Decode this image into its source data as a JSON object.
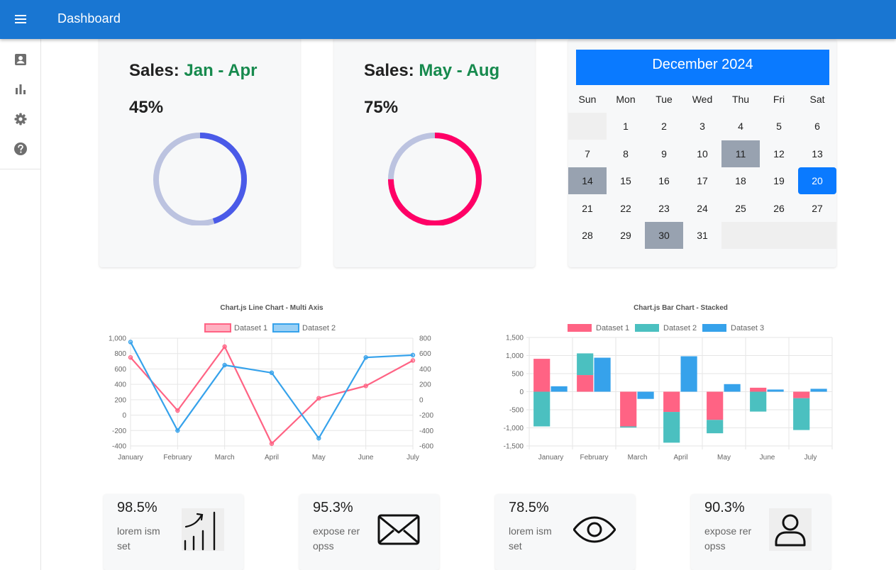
{
  "appbar": {
    "title": "Dashboard",
    "menu_icon": "menu-icon"
  },
  "sidebar": {
    "items": [
      {
        "icon": "contact-card-icon"
      },
      {
        "icon": "bar-chart-icon"
      },
      {
        "icon": "gear-icon"
      },
      {
        "icon": "help-icon"
      }
    ]
  },
  "sales": [
    {
      "prefix": "Sales: ",
      "range": "Jan - Apr",
      "percent_label": "45%",
      "percent": 45,
      "color": "#4a5ae8",
      "track": "#bcc3e0"
    },
    {
      "prefix": "Sales: ",
      "range": "May - Aug",
      "percent_label": "75%",
      "percent": 75,
      "color": "#ff0066",
      "track": "#bcc3e0"
    }
  ],
  "calendar": {
    "title": "December 2024",
    "weekdays": [
      "Sun",
      "Mon",
      "Tue",
      "Wed",
      "Thu",
      "Fri",
      "Sat"
    ],
    "days": [
      "1",
      "2",
      "3",
      "4",
      "5",
      "6",
      "7",
      "8",
      "9",
      "10",
      "11",
      "12",
      "13",
      "14",
      "15",
      "16",
      "17",
      "18",
      "19",
      "20",
      "21",
      "22",
      "23",
      "24",
      "25",
      "26",
      "27",
      "28",
      "29",
      "30",
      "31"
    ],
    "first_weekday": 1,
    "highlighted_days": [
      "11",
      "14",
      "30"
    ],
    "today": "20",
    "accent": "#0a7aff"
  },
  "chart_data": [
    {
      "type": "line",
      "title": "Chart.js Line Chart - Multi Axis",
      "categories": [
        "January",
        "February",
        "March",
        "April",
        "May",
        "June",
        "July"
      ],
      "series": [
        {
          "name": "Dataset 1",
          "axis": "left",
          "values": [
            750,
            60,
            890,
            -370,
            220,
            380,
            710
          ],
          "color": "#ff6384"
        },
        {
          "name": "Dataset 2",
          "axis": "right",
          "values": [
            750,
            -400,
            450,
            350,
            -500,
            550,
            580
          ],
          "color": "#36a2eb"
        }
      ],
      "y_left": {
        "ylim": [
          -400,
          1000
        ],
        "ticks": [
          "1,000",
          "800",
          "600",
          "400",
          "200",
          "0",
          "-200",
          "-400"
        ]
      },
      "y_right": {
        "ylim": [
          -600,
          800
        ],
        "ticks": [
          "800",
          "600",
          "400",
          "200",
          "0",
          "-200",
          "-400",
          "-600"
        ]
      },
      "grid": true,
      "legend": "top"
    },
    {
      "type": "bar",
      "stacked": true,
      "title": "Chart.js Bar Chart - Stacked",
      "categories": [
        "January",
        "February",
        "March",
        "April",
        "May",
        "June",
        "July"
      ],
      "series": [
        {
          "name": "Dataset 1",
          "stack": "a",
          "values": [
            910,
            460,
            -960,
            -560,
            -780,
            110,
            -180
          ],
          "color": "#ff6384"
        },
        {
          "name": "Dataset 2",
          "stack": "a",
          "values": [
            -960,
            600,
            -30,
            -850,
            -370,
            -550,
            -880
          ],
          "color": "#4bc0c0"
        },
        {
          "name": "Dataset 3",
          "stack": "b",
          "values": [
            150,
            940,
            -200,
            980,
            210,
            60,
            80
          ],
          "color": "#36a2eb"
        }
      ],
      "ylim": [
        -1500,
        1500
      ],
      "ticks": [
        "1,500",
        "1,000",
        "500",
        "0",
        "-500",
        "-1,000",
        "-1,500"
      ],
      "grid": true,
      "legend": "top"
    }
  ],
  "stats": [
    {
      "value": "98.5%",
      "label": "lorem ism set",
      "icon": "growth-chart-icon"
    },
    {
      "value": "95.3%",
      "label": "expose rer opss",
      "icon": "mail-icon"
    },
    {
      "value": "78.5%",
      "label": "lorem ism set",
      "icon": "eye-icon"
    },
    {
      "value": "90.3%",
      "label": "expose rer opss",
      "icon": "user-icon"
    }
  ]
}
